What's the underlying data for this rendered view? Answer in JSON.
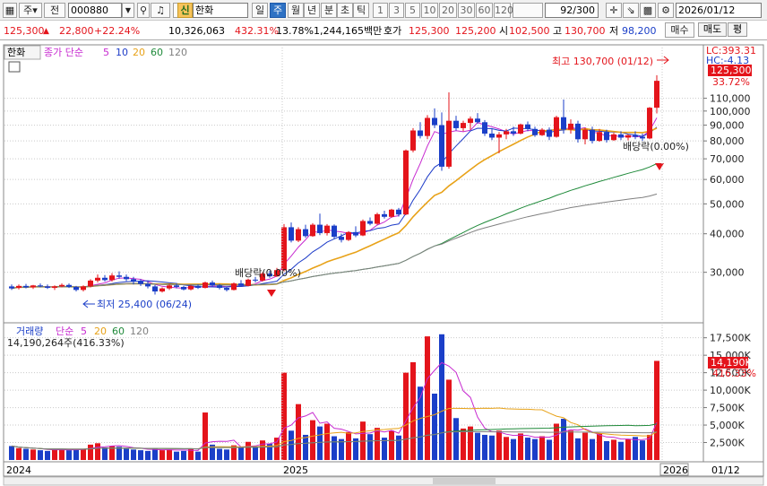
{
  "toolbar": {
    "market": "주",
    "prev_label": "전",
    "code": "000880",
    "name": "한화",
    "name_badge": "신",
    "periods": [
      {
        "label": "일",
        "active": false
      },
      {
        "label": "주",
        "active": true
      },
      {
        "label": "월",
        "active": false
      },
      {
        "label": "년",
        "active": false
      },
      {
        "label": "분",
        "active": false
      },
      {
        "label": "초",
        "active": false
      },
      {
        "label": "틱",
        "active": false
      }
    ],
    "intervals": [
      "1",
      "3",
      "5",
      "10",
      "20",
      "30",
      "60",
      "120"
    ],
    "count": "92/300",
    "date": "2026/01/12"
  },
  "quote": {
    "price": "125,300",
    "change": "22,800",
    "change_pct": "+22.24%",
    "volume": "10,326,063",
    "volume_ratio": "432.31%",
    "turnover": "13.78%",
    "amount": "1,244,165백만",
    "hoga_label": "호가",
    "ask": "125,300",
    "bid": "125,200",
    "open_label": "시",
    "open": "102,500",
    "high_label": "고",
    "high": "130,700",
    "low_label": "저",
    "low": "98,200",
    "buy_label": "매수",
    "sell_label": "매도",
    "eval_label": "평"
  },
  "price_panel": {
    "name": "한화",
    "ma_title": "종가 단순",
    "ma_periods": [
      "5",
      "10",
      "20",
      "60",
      "120"
    ],
    "lc": "LC:393.31",
    "hc": "HC:-4.13",
    "current": "125,300",
    "current_pct": "33.72%",
    "high_note": "최고 130,700 (01/12)",
    "low_note": "최저 25,400 (06/24)",
    "dividend_1": "배당락(0.00%)",
    "dividend_2": "배당락(0.00%)",
    "yticks": [
      "110,000",
      "100,000",
      "90,000",
      "80,000",
      "70,000",
      "60,000",
      "50,000",
      "40,000",
      "30,000"
    ]
  },
  "volume_panel": {
    "title": "거래량",
    "ma_title": "단순",
    "ma_periods": [
      "5",
      "20",
      "60",
      "120"
    ],
    "info": "14,190,264주(416.33%)",
    "current": "14,190K",
    "current_pct": "416.33%",
    "yticks": [
      "17,500K",
      "15,000K",
      "12,500K",
      "10,000K",
      "7,500K",
      "5,000K",
      "2,500K"
    ]
  },
  "xaxis": [
    "2024",
    "2025",
    "2026",
    "01/12"
  ],
  "colors": {
    "up": "#e4141b",
    "down": "#1b3fc8",
    "ma5": "#c72ad0",
    "ma10": "#1e3cc8",
    "ma20": "#e8a218",
    "ma60": "#1f8a3a",
    "ma120": "#808080",
    "grid": "#c9c9c9"
  },
  "chart_data": {
    "type": "candlestick",
    "interval": "weekly",
    "price_scale": "log",
    "price_ylim": [
      22000,
      135000
    ],
    "volume_ylim": [
      0,
      19000000
    ],
    "candles": [
      [
        27000,
        27400,
        26300,
        26600,
        2000000
      ],
      [
        26700,
        27400,
        26400,
        27100,
        1700000
      ],
      [
        27100,
        27500,
        26600,
        26800,
        1600000
      ],
      [
        26800,
        27300,
        26500,
        27200,
        1500000
      ],
      [
        27200,
        27600,
        26800,
        27000,
        1400000
      ],
      [
        27000,
        27400,
        26500,
        26700,
        1300000
      ],
      [
        26700,
        27200,
        26300,
        27000,
        1500000
      ],
      [
        27000,
        27600,
        26800,
        27300,
        1600000
      ],
      [
        27300,
        27600,
        26700,
        26900,
        1400000
      ],
      [
        26900,
        27100,
        26000,
        26300,
        1500000
      ],
      [
        26300,
        27200,
        26000,
        27000,
        1600000
      ],
      [
        27000,
        28500,
        26800,
        28200,
        2200000
      ],
      [
        28200,
        29500,
        27800,
        28800,
        2400000
      ],
      [
        28800,
        29400,
        28000,
        28300,
        1800000
      ],
      [
        28300,
        29800,
        28000,
        29300,
        2000000
      ],
      [
        29300,
        30200,
        28600,
        29000,
        1900000
      ],
      [
        29000,
        29500,
        28100,
        28500,
        1600000
      ],
      [
        28500,
        29000,
        27400,
        28000,
        1500000
      ],
      [
        28000,
        28500,
        27100,
        27500,
        1400000
      ],
      [
        27500,
        28000,
        26600,
        27000,
        1300000
      ],
      [
        27000,
        27300,
        25400,
        26000,
        1700000
      ],
      [
        26000,
        26800,
        25800,
        26600,
        1400000
      ],
      [
        26600,
        27500,
        26300,
        27200,
        1500000
      ],
      [
        27200,
        27600,
        26600,
        26900,
        1200000
      ],
      [
        26900,
        27100,
        26200,
        26400,
        1300000
      ],
      [
        26400,
        27300,
        26200,
        27100,
        1600000
      ],
      [
        27100,
        27400,
        26500,
        26700,
        1200000
      ],
      [
        26700,
        28000,
        26600,
        27800,
        6800000
      ],
      [
        27800,
        28200,
        26900,
        27200,
        2200000
      ],
      [
        27200,
        27500,
        26400,
        26700,
        1600000
      ],
      [
        26700,
        27000,
        26000,
        26300,
        1500000
      ],
      [
        26300,
        27800,
        26200,
        27600,
        2100000
      ],
      [
        27600,
        28300,
        26900,
        27100,
        1900000
      ],
      [
        27100,
        28600,
        27000,
        28400,
        2600000
      ],
      [
        28400,
        29000,
        27800,
        28200,
        2000000
      ],
      [
        28200,
        30000,
        28000,
        29700,
        2800000
      ],
      [
        29700,
        30300,
        28800,
        29100,
        2300000
      ],
      [
        29100,
        31000,
        29000,
        30500,
        3200000
      ],
      [
        30500,
        43000,
        30200,
        42000,
        12500000
      ],
      [
        42000,
        43500,
        37500,
        38000,
        4200000
      ],
      [
        38000,
        42000,
        37600,
        41400,
        8000000
      ],
      [
        41400,
        42800,
        38800,
        39300,
        3600000
      ],
      [
        39300,
        43300,
        39100,
        42800,
        5700000
      ],
      [
        42800,
        46500,
        39600,
        40200,
        4800000
      ],
      [
        40200,
        43000,
        39500,
        42500,
        5200000
      ],
      [
        42500,
        42900,
        38600,
        39100,
        3400000
      ],
      [
        39100,
        40000,
        37500,
        38200,
        3000000
      ],
      [
        38200,
        40800,
        37900,
        40500,
        4000000
      ],
      [
        40500,
        42300,
        39000,
        39500,
        3100000
      ],
      [
        39500,
        44500,
        39300,
        44000,
        5500000
      ],
      [
        44000,
        45200,
        42600,
        43100,
        3700000
      ],
      [
        43100,
        46800,
        42800,
        46300,
        4600000
      ],
      [
        46300,
        47500,
        44800,
        45400,
        3200000
      ],
      [
        45400,
        48200,
        45100,
        47900,
        4200000
      ],
      [
        47900,
        48500,
        45500,
        46200,
        3500000
      ],
      [
        46200,
        75000,
        46000,
        74500,
        12500000
      ],
      [
        74500,
        88000,
        73500,
        86500,
        14000000
      ],
      [
        86500,
        92000,
        81500,
        83000,
        10500000
      ],
      [
        83000,
        97000,
        81000,
        95000,
        17700000
      ],
      [
        95000,
        102000,
        88000,
        90000,
        9500000
      ],
      [
        90000,
        99000,
        64000,
        66000,
        18000000
      ],
      [
        66000,
        115000,
        65000,
        93000,
        11500000
      ],
      [
        93000,
        96500,
        86500,
        88000,
        6000000
      ],
      [
        88000,
        93000,
        86000,
        91500,
        4500000
      ],
      [
        91500,
        96000,
        87000,
        94500,
        4800000
      ],
      [
        94500,
        98500,
        91000,
        92000,
        3900000
      ],
      [
        92000,
        93500,
        83000,
        84500,
        3600000
      ],
      [
        84500,
        88000,
        80500,
        82000,
        3500000
      ],
      [
        82000,
        85500,
        73000,
        84000,
        4200000
      ],
      [
        84000,
        87500,
        81000,
        86000,
        3300000
      ],
      [
        86000,
        89000,
        83000,
        84500,
        3000000
      ],
      [
        84500,
        91000,
        84000,
        90500,
        3800000
      ],
      [
        90500,
        92500,
        86000,
        87500,
        3200000
      ],
      [
        87500,
        89000,
        82500,
        83500,
        3000000
      ],
      [
        83500,
        88000,
        83000,
        87000,
        3400000
      ],
      [
        87000,
        88500,
        80500,
        82500,
        2900000
      ],
      [
        82500,
        96500,
        82000,
        95500,
        5200000
      ],
      [
        95500,
        109000,
        84500,
        87000,
        5900000
      ],
      [
        87000,
        94000,
        84500,
        91000,
        4200000
      ],
      [
        91000,
        93000,
        79000,
        81000,
        3100000
      ],
      [
        81000,
        88000,
        78000,
        87000,
        3900000
      ],
      [
        87000,
        89000,
        78500,
        80000,
        3000000
      ],
      [
        80000,
        87500,
        79500,
        85500,
        3800000
      ],
      [
        85500,
        87000,
        79000,
        80500,
        2700000
      ],
      [
        80500,
        85000,
        80000,
        84000,
        2900000
      ],
      [
        84000,
        86000,
        80500,
        82000,
        2600000
      ],
      [
        82000,
        84000,
        80300,
        83500,
        3000000
      ],
      [
        83500,
        86000,
        81000,
        82500,
        3300000
      ],
      [
        82500,
        84500,
        80000,
        81500,
        2800000
      ],
      [
        81500,
        103000,
        81000,
        102500,
        3600000
      ],
      [
        102500,
        130700,
        98200,
        125300,
        14190000
      ]
    ]
  }
}
